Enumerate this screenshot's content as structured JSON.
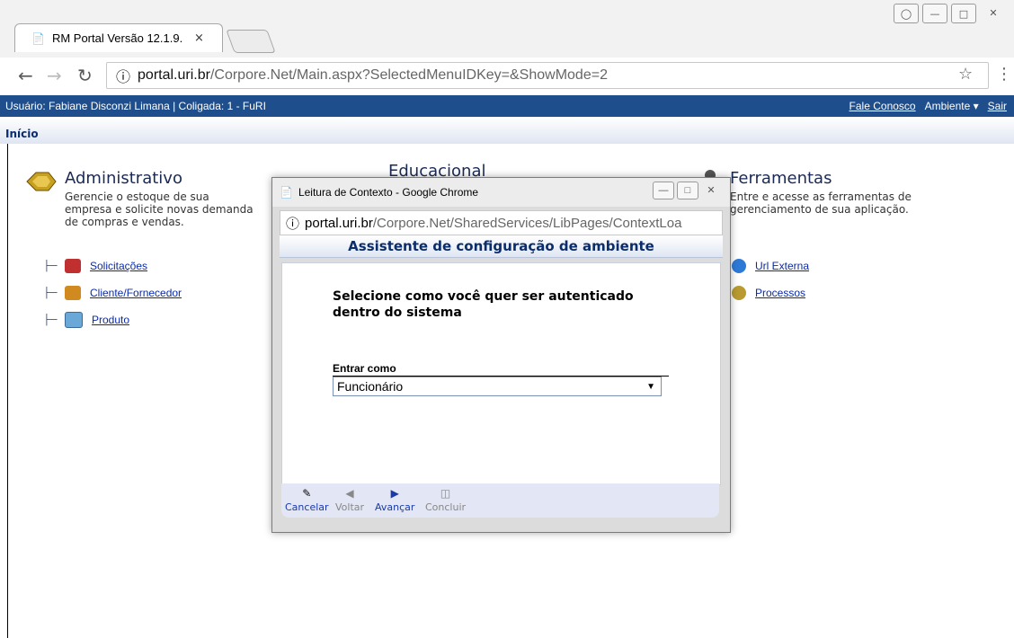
{
  "browser": {
    "tab_title": "RM Portal Versão 12.1.9.",
    "tab_close": "×",
    "url_host": "portal.uri.br",
    "url_path": "/Corpore.Net/Main.aspx?SelectedMenuIDKey=&ShowMode=2"
  },
  "portal": {
    "user_text": "Usuário: Fabiane Disconzi Limana  |  Coligada: 1 - FuRI",
    "fale_conosco": "Fale Conosco",
    "ambiente": "Ambiente ▾",
    "sair": "Sair",
    "breadcrumb": "Início"
  },
  "modules": {
    "administrativo": {
      "title": "Administrativo",
      "desc1": "Gerencie o estoque de sua",
      "desc2": "empresa e solicite novas demanda",
      "desc3": "de compras e vendas.",
      "items": [
        "Solicitações",
        "Cliente/Fornecedor",
        "Produto"
      ]
    },
    "educacional": {
      "title": "Educacional"
    },
    "ferramentas": {
      "title": "Ferramentas",
      "desc1": "Entre e acesse as ferramentas de",
      "desc2": "gerenciamento de sua aplicação.",
      "items": [
        "Url Externa",
        "Processos"
      ]
    }
  },
  "popup": {
    "window_title": "Leitura de Contexto - Google Chrome",
    "url_host": "portal.uri.br",
    "url_path": "/Corpore.Net/SharedServices/LibPages/ContextLoa",
    "header": "Assistente de configuração de ambiente",
    "question": "Selecione como você quer ser autenticado dentro do sistema",
    "field_label": "Entrar como",
    "selected_value": "Funcionário",
    "buttons": [
      "Cancelar",
      "Voltar",
      "Avançar",
      "Concluir"
    ]
  },
  "colors": {
    "portal_bar": "#1f4e8c",
    "link": "#0b2aa6"
  }
}
